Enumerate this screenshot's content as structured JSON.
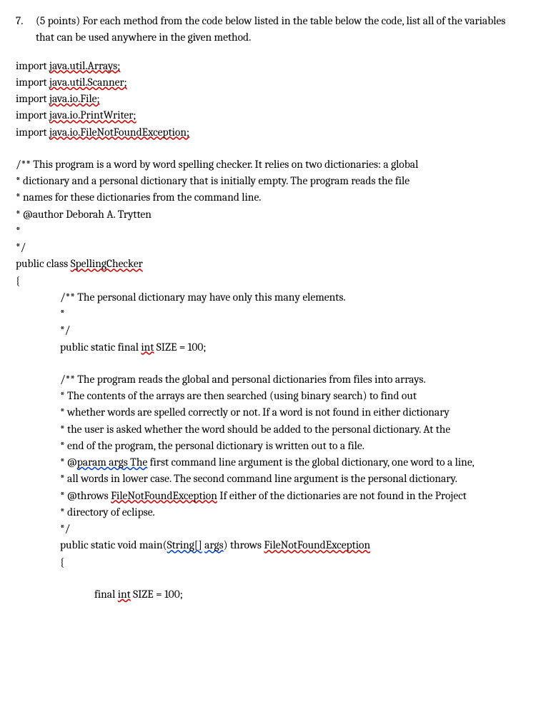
{
  "question": {
    "number": "7.",
    "points": "(5 points)",
    "text": "For each method from the code below listed in the table below the code, list all of the variables that can be used anywhere in the given method."
  },
  "imports": {
    "kw": "import",
    "p1": "java.util.Arrays;",
    "p2": "java.util.Scanner;",
    "p3": "java.io.File;",
    "p4": "java.io.PrintWriter;",
    "p5": "java.io.FileNotFoundException;"
  },
  "cmt": {
    "l1": "/** This program is a word by word spelling checker.  It relies on two dictionaries: a global",
    "l2": " * dictionary and a personal dictionary that is initially empty.  The program reads the file",
    "l3": " * names for these dictionaries from the command line.",
    "l4": " * @author Deborah A. Trytten",
    "l5": " *",
    "l6": " */"
  },
  "cls": {
    "decl_pre": "public class ",
    "name": "SpellingChecker",
    "open": "{"
  },
  "field": {
    "c1": "/** The personal dictionary may have only this many elements.",
    "c2": " *",
    "c3": " */",
    "decl_pre": "public static final ",
    "int_kw": "int",
    "decl_post": " SIZE = 100;"
  },
  "mcmt": {
    "l1": "/** The program reads the global and personal dictionaries from files into arrays.",
    "l2_1": " * The contents of the arrays are then searched (using binary search) to find out",
    "l3_1": " * whether words are spelled correctly or not.  If a word is not found in either dictionary",
    "l4_1": " * the user is asked whether the word should be added to the personal dictionary. At the",
    "l5": " * end of the program, the personal dictionary is written out to a file.",
    "l6_pre": " * @",
    "l6_param": "param args The",
    "l6_post": " first command line argument is the global dictionary, one word to a line,",
    "l7_1": " * all words in lower case.  The second command line argument is the personal dictionary.",
    "l8_pre": " * @throws ",
    "l8_ex": "FileNotFoundException",
    "l8_post": " If either of the dictionaries are not found in the Project",
    "l9": " * directory of eclipse.",
    "l10": " */"
  },
  "main": {
    "pre": "public static void main(",
    "string": "String[]",
    "args": "args",
    "mid": ") throws ",
    "ex": "FileNotFoundException",
    "open": "{",
    "local_pre": "final ",
    "local_int": "int",
    "local_post": " SIZE = 100;"
  }
}
